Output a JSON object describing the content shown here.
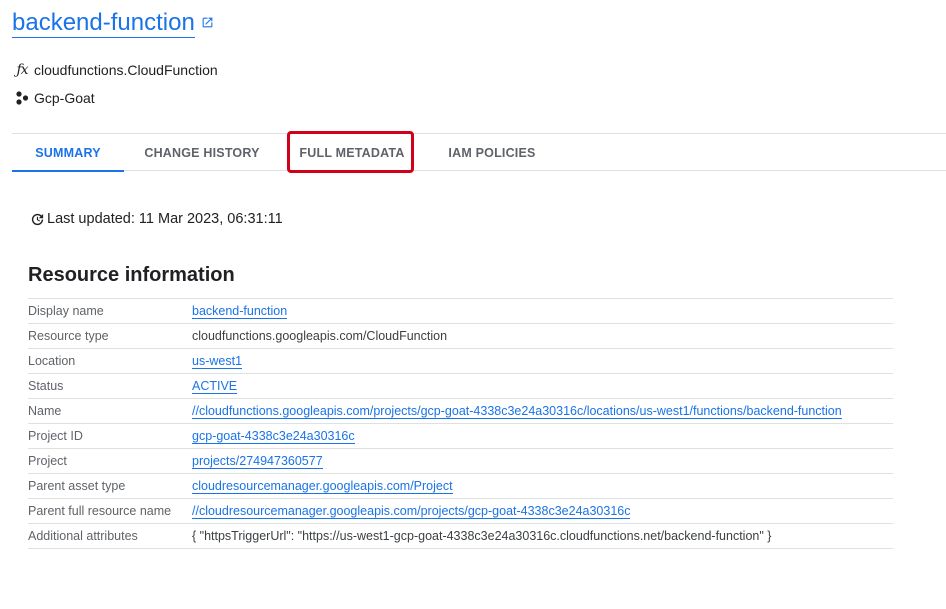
{
  "header": {
    "title": "backend-function",
    "resource_type": "cloudfunctions.CloudFunction",
    "project": "Gcp-Goat"
  },
  "tabs": [
    {
      "label": "SUMMARY",
      "active": true
    },
    {
      "label": "CHANGE HISTORY",
      "active": false
    },
    {
      "label": "FULL METADATA",
      "active": false,
      "highlighted": true
    },
    {
      "label": "IAM POLICIES",
      "active": false
    }
  ],
  "last_updated": "Last updated: 11 Mar 2023, 06:31:11",
  "resource_info": {
    "title": "Resource information",
    "rows": [
      {
        "key": "Display name",
        "value": "backend-function",
        "link": true
      },
      {
        "key": "Resource type",
        "value": "cloudfunctions.googleapis.com/CloudFunction",
        "link": false
      },
      {
        "key": "Location",
        "value": "us-west1",
        "link": true
      },
      {
        "key": "Status",
        "value": "ACTIVE",
        "link": true
      },
      {
        "key": "Name",
        "value": "//cloudfunctions.googleapis.com/projects/gcp-goat-4338c3e24a30316c/locations/us-west1/functions/backend-function",
        "link": true
      },
      {
        "key": "Project ID",
        "value": "gcp-goat-4338c3e24a30316c",
        "link": true
      },
      {
        "key": "Project",
        "value": "projects/274947360577",
        "link": true
      },
      {
        "key": "Parent asset type",
        "value": "cloudresourcemanager.googleapis.com/Project",
        "link": true
      },
      {
        "key": "Parent full resource name",
        "value": "//cloudresourcemanager.googleapis.com/projects/gcp-goat-4338c3e24a30316c",
        "link": true
      },
      {
        "key": "Additional attributes",
        "value": "{ \"httpsTriggerUrl\": \"https://us-west1-gcp-goat-4338c3e24a30316c.cloudfunctions.net/backend-function\" }",
        "link": false
      }
    ]
  },
  "colors": {
    "accent": "#1a73e8",
    "highlight": "#d0021b"
  }
}
